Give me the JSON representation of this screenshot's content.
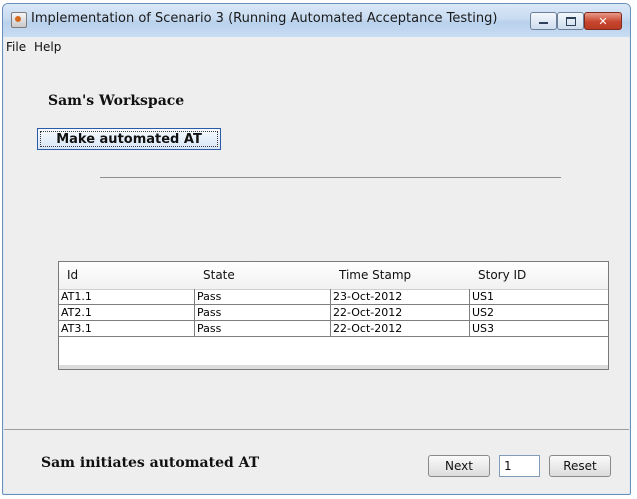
{
  "window": {
    "title": "Implementation of Scenario 3 (Running Automated Acceptance Testing)",
    "icon": "java-app-icon",
    "controls": {
      "minimize": "minimize-icon",
      "maximize": "maximize-icon",
      "close": "✕"
    }
  },
  "menu": [
    "File",
    "Help"
  ],
  "workspace": {
    "title": "Sam's Workspace",
    "action_label": "Make automated AT"
  },
  "table": {
    "headers": [
      "Id",
      "State",
      "Time Stamp",
      "Story ID"
    ],
    "rows": [
      [
        "AT1.1",
        "Pass",
        "23-Oct-2012",
        "US1"
      ],
      [
        "AT2.1",
        "Pass",
        "22-Oct-2012",
        "US2"
      ],
      [
        "AT3.1",
        "Pass",
        "22-Oct-2012",
        "US3"
      ]
    ]
  },
  "footer": {
    "status": "Sam initiates automated AT",
    "next_label": "Next",
    "step_value": "1",
    "reset_label": "Reset"
  },
  "colors": {
    "titlebar": "#c7dbf1",
    "close_button": "#c8452e",
    "panel_background": "#eeeeee"
  }
}
